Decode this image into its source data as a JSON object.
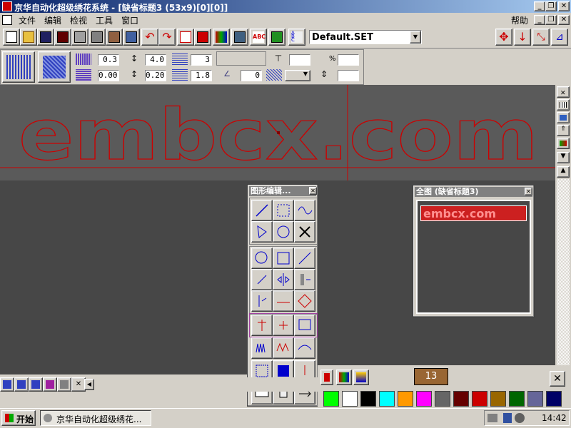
{
  "window": {
    "title": "京华自动化超级绣花系统 - [缺省标题3 (53x9)[0][0]]",
    "min": "_",
    "restore": "❐",
    "close": "✕"
  },
  "menu": {
    "items": [
      "文件",
      "编辑",
      "检视",
      "工具",
      "窗口"
    ],
    "help": "帮助"
  },
  "toolbar": {
    "settings_file": "Default.SET"
  },
  "params": {
    "v1": "0.3",
    "v2": "4.0",
    "v3": "3",
    "v4": "0.00",
    "v5": "0.20",
    "v6": "1.8",
    "v7": "0",
    "percent": "%"
  },
  "canvas": {
    "design_text": "embcx.com",
    "outline_color": "#cc0000"
  },
  "palette": {
    "title": "图形编辑..."
  },
  "overview": {
    "title": "全图 (缺省标题3)",
    "preview_text": "embcx.com"
  },
  "colorbar": {
    "current_color_index": "13",
    "colors": [
      "#00ff00",
      "#ffffff",
      "#000000",
      "#00ffff",
      "#ff9900",
      "#ff00ff",
      "#666666",
      "#660000",
      "#cc0000",
      "#996600",
      "#006600",
      "#666699",
      "#000066"
    ]
  },
  "taskbar": {
    "start": "开始",
    "task": "京华自动化超级绣花...",
    "time": "14:42"
  }
}
